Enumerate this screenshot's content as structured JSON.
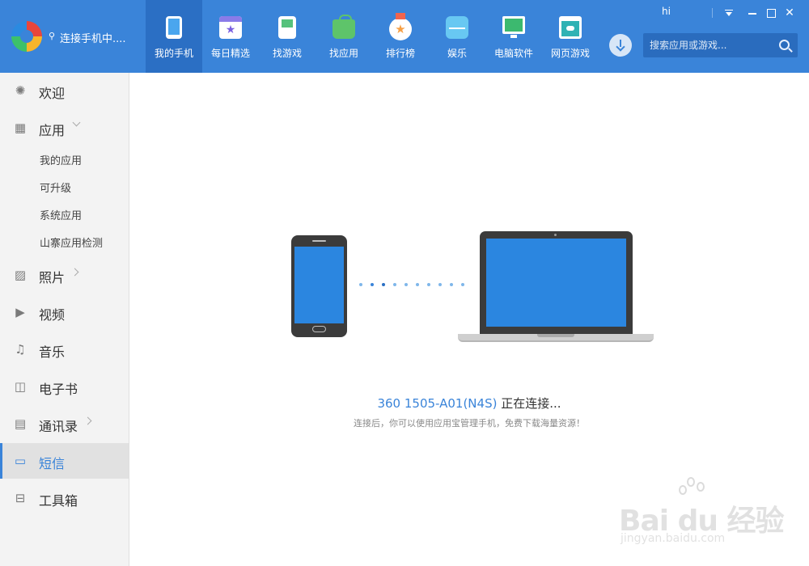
{
  "brand": {
    "text": "连接手机中...."
  },
  "nav": [
    {
      "label": "我的手机",
      "icon": "phone-icon",
      "active": true
    },
    {
      "label": "每日精选",
      "icon": "calendar-star-icon"
    },
    {
      "label": "找游戏",
      "icon": "gamepad-icon"
    },
    {
      "label": "找应用",
      "icon": "android-bag-icon"
    },
    {
      "label": "排行榜",
      "icon": "medal-icon"
    },
    {
      "label": "娱乐",
      "icon": "play-box-icon"
    },
    {
      "label": "电脑软件",
      "icon": "monitor-windows-icon"
    },
    {
      "label": "网页游戏",
      "icon": "browser-game-icon"
    }
  ],
  "search": {
    "placeholder": "搜索应用或游戏..."
  },
  "window": {
    "user": "hi"
  },
  "sidebar": {
    "items": [
      {
        "label": "欢迎"
      },
      {
        "label": "应用"
      },
      {
        "label": "照片"
      },
      {
        "label": "视频"
      },
      {
        "label": "音乐"
      },
      {
        "label": "电子书"
      },
      {
        "label": "通讯录"
      },
      {
        "label": "短信",
        "active": true
      },
      {
        "label": "工具箱"
      }
    ],
    "app_sub": [
      {
        "label": "我的应用"
      },
      {
        "label": "可升级"
      },
      {
        "label": "系统应用"
      },
      {
        "label": "山寨应用检测"
      }
    ]
  },
  "main": {
    "device_name": "360 1505-A01(N4S)",
    "status_text": " 正在连接...",
    "hint": "连接后，你可以使用应用宝管理手机，免费下载海量资源！",
    "accent": "#3a84d9"
  },
  "watermark": {
    "text": "Bai du 经验",
    "url": "jingyan.baidu.com"
  }
}
